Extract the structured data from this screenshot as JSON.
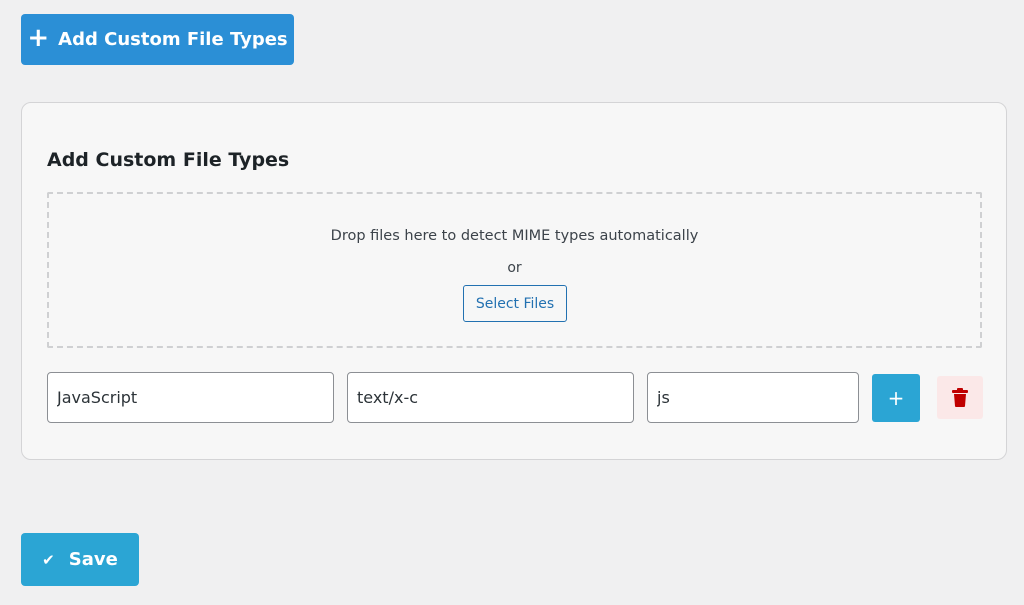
{
  "header": {
    "add_button_label": "Add Custom File Types",
    "add_button_icon": "plus-icon"
  },
  "panel": {
    "title": "Add Custom File Types",
    "dropzone": {
      "text": "Drop files here to detect MIME types automatically",
      "or_text": "or",
      "select_button_label": "Select Files"
    },
    "row": {
      "name_value": "JavaScript",
      "mime_value": "text/x-c",
      "extension_value": "js",
      "add_button_label": "+",
      "delete_icon": "trash-icon"
    }
  },
  "footer": {
    "save_label": "Save",
    "save_icon": "check-icon"
  },
  "colors": {
    "primary_blue": "#2b8fd6",
    "accent_blue": "#2ba5d4",
    "link_blue": "#2271b1",
    "delete_red": "#c00000",
    "delete_bg": "#fbe8e8"
  }
}
